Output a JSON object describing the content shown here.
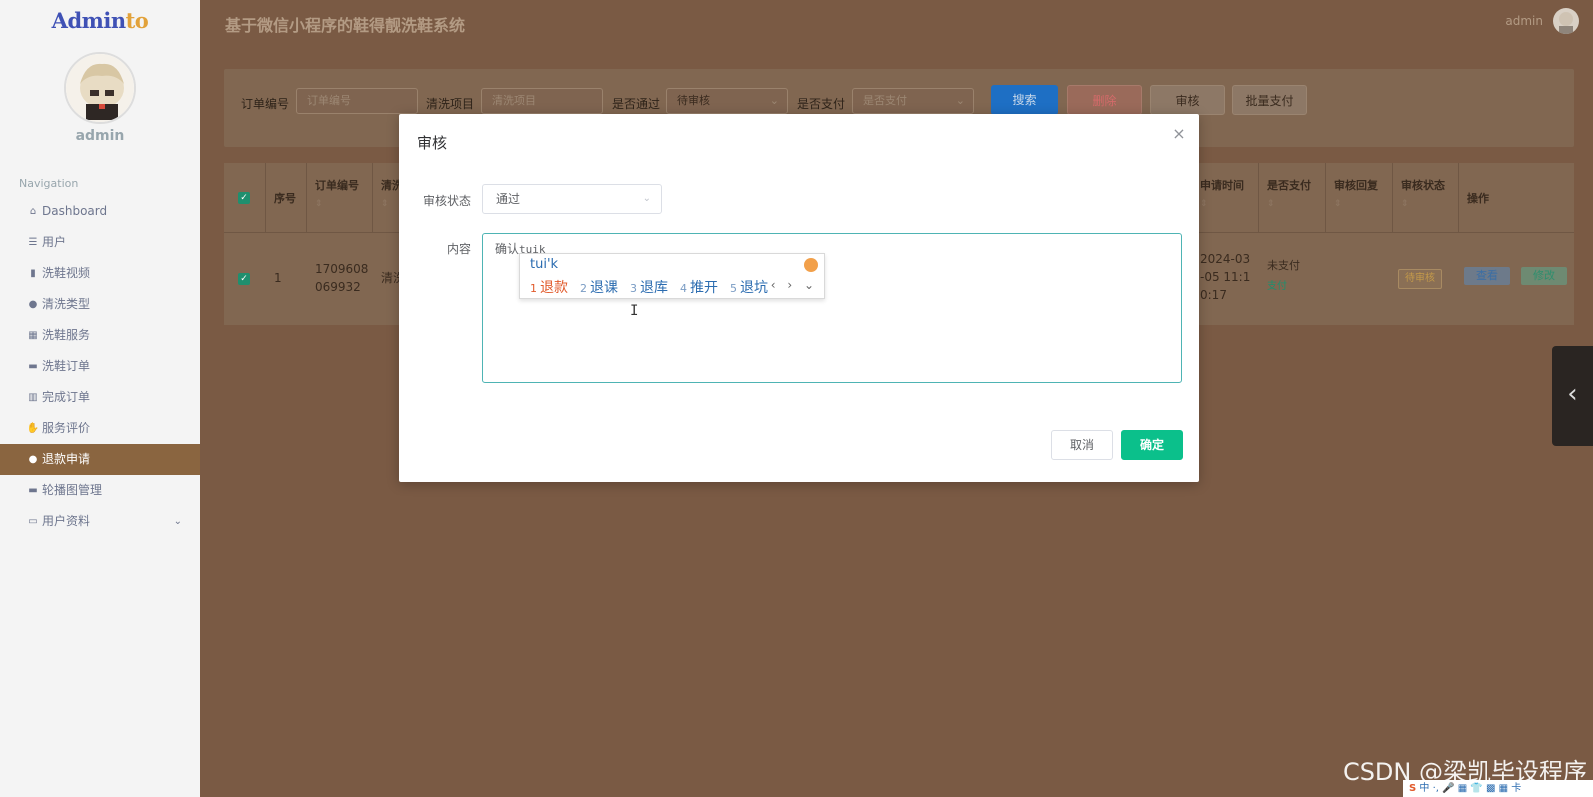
{
  "brand": {
    "main": "Admin",
    "accent": "to"
  },
  "sidebar": {
    "username": "admin",
    "nav_title": "Navigation",
    "items": [
      {
        "label": "Dashboard",
        "icon": "home-icon"
      },
      {
        "label": "用户",
        "icon": "list-icon"
      },
      {
        "label": "洗鞋视频",
        "icon": "clipboard-icon"
      },
      {
        "label": "清洗类型",
        "icon": "pin-icon"
      },
      {
        "label": "洗鞋服务",
        "icon": "grid-icon"
      },
      {
        "label": "洗鞋订单",
        "icon": "monitor-icon"
      },
      {
        "label": "完成订单",
        "icon": "bar-chart-icon"
      },
      {
        "label": "服务评价",
        "icon": "thumb-up-icon"
      },
      {
        "label": "退款申请",
        "icon": "user-icon",
        "active": true
      },
      {
        "label": "轮播图管理",
        "icon": "monitor-icon"
      },
      {
        "label": "用户资料",
        "icon": "folder-icon",
        "has_children": true
      }
    ]
  },
  "header": {
    "title": "基于微信小程序的鞋得靓洗鞋系统",
    "user": "admin"
  },
  "search": {
    "order_no_label": "订单编号",
    "order_no_placeholder": "订单编号",
    "item_label": "清洗项目",
    "item_placeholder": "清洗项目",
    "pass_label": "是否通过",
    "pass_value": "待审核",
    "paid_label": "是否支付",
    "paid_placeholder": "是否支付",
    "btn_search": "搜索",
    "btn_delete": "删除",
    "btn_review": "审核",
    "btn_batch_pay": "批量支付"
  },
  "table": {
    "headers": {
      "seq": "序号",
      "order_no": "订单编号",
      "item": "清洗",
      "apply_time": "申请时间",
      "paid": "是否支付",
      "reply": "审核回复",
      "status": "审核状态",
      "actions": "操作"
    },
    "rows": [
      {
        "seq": "1",
        "order_no_1": "1709608",
        "order_no_2": "069932",
        "item": "清洗",
        "time_1": "2024-03",
        "time_2": "-05 11:1",
        "time_3": "0:17",
        "paid": "未支付",
        "pay_link": "支付",
        "reply": "",
        "status": "待审核",
        "btn_view": "查看",
        "btn_edit": "修改"
      }
    ]
  },
  "modal": {
    "title": "审核",
    "status_label": "审核状态",
    "status_value": "通过",
    "content_label": "内容",
    "content_text": "确认",
    "content_typing": "tuik",
    "btn_cancel": "取消",
    "btn_ok": "确定"
  },
  "ime": {
    "input": "tui'k",
    "candidates": [
      {
        "num": "1",
        "text": "退款"
      },
      {
        "num": "2",
        "text": "退课"
      },
      {
        "num": "3",
        "text": "退库"
      },
      {
        "num": "4",
        "text": "推开"
      },
      {
        "num": "5",
        "text": "退坑"
      }
    ],
    "nav": "‹ › ⌄",
    "tray": "中 ·, 🎤 ▦ 👕 ▩ ▦ 卡"
  },
  "watermark": "CSDN @梁凯毕设程序",
  "colors": {
    "accent": "#8a6540",
    "primary": "#0bc08b",
    "search_btn": "#1e6fc4"
  }
}
